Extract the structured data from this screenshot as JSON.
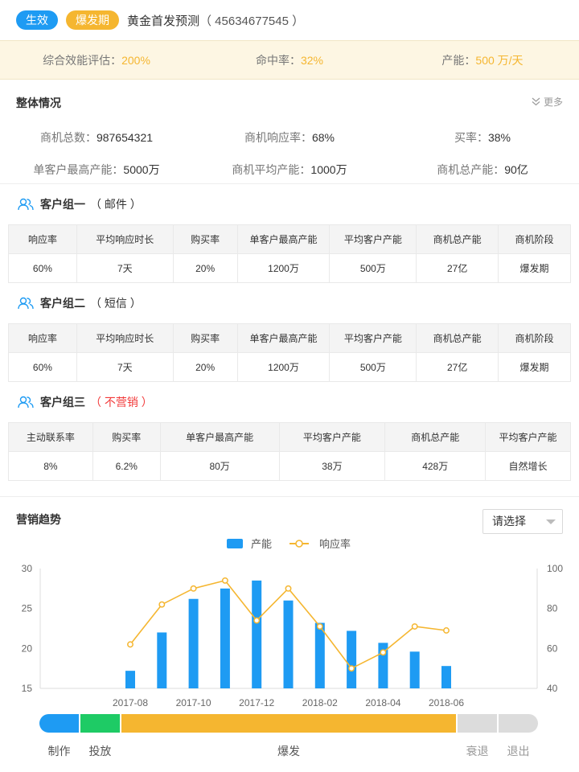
{
  "header": {
    "tag_active": "生效",
    "tag_phase": "爆发期",
    "title": "黄金首发预测",
    "id_text": "（ 45634677545 ）"
  },
  "summary": [
    {
      "label": "综合效能评估：",
      "value": "200%"
    },
    {
      "label": "命中率：",
      "value": "32%"
    },
    {
      "label": "产能：",
      "value": "500 万/天"
    }
  ],
  "overall": {
    "title": "整体情况",
    "more": "更多",
    "stats": [
      {
        "label": "商机总数：",
        "value": "987654321"
      },
      {
        "label": "商机响应率：",
        "value": "68%"
      },
      {
        "label": "买率：",
        "value": "38%"
      },
      {
        "label": "单客户最高产能：",
        "value": "5000万"
      },
      {
        "label": "商机平均产能：",
        "value": "1000万"
      },
      {
        "label": "商机总产能：",
        "value": "90亿"
      }
    ]
  },
  "groups": [
    {
      "title": "客户组一",
      "channel": "（ 邮件 ）",
      "headers": [
        "响应率",
        "平均响应时长",
        "购买率",
        "单客户最高产能",
        "平均客户产能",
        "商机总产能",
        "商机阶段"
      ],
      "row": [
        "60%",
        "7天",
        "20%",
        "1200万",
        "500万",
        "27亿",
        "爆发期"
      ]
    },
    {
      "title": "客户组二",
      "channel": "（ 短信 ）",
      "headers": [
        "响应率",
        "平均响应时长",
        "购买率",
        "单客户最高产能",
        "平均客户产能",
        "商机总产能",
        "商机阶段"
      ],
      "row": [
        "60%",
        "7天",
        "20%",
        "1200万",
        "500万",
        "27亿",
        "爆发期"
      ]
    },
    {
      "title": "客户组三",
      "channel": "（ 不营销 ）",
      "headers": [
        "主动联系率",
        "购买率",
        "单客户最高产能",
        "平均客户产能",
        "商机总产能",
        "平均客户产能"
      ],
      "row": [
        "8%",
        "6.2%",
        "80万",
        "38万",
        "428万",
        "自然增长"
      ]
    }
  ],
  "trend": {
    "title": "营销趋势",
    "select_placeholder": "请选择",
    "phases": [
      {
        "label": "制作",
        "color": "#1e9bf3",
        "weight": 1,
        "label_color": "#555"
      },
      {
        "label": "投放",
        "color": "#1ecb65",
        "weight": 1,
        "label_color": "#555"
      },
      {
        "label": "爆发",
        "color": "#f5b630",
        "weight": 8.5,
        "label_color": "#555"
      },
      {
        "label": "衰退",
        "color": "#dcdcdc",
        "weight": 1,
        "label_color": "#999"
      },
      {
        "label": "退出",
        "color": "#dcdcdc",
        "weight": 1,
        "label_color": "#999"
      }
    ]
  },
  "chart_data": {
    "type": "bar",
    "x": [
      "2017-08",
      "2017-09",
      "2017-10",
      "2017-11",
      "2017-12",
      "2018-01",
      "2018-02",
      "2018-03",
      "2018-04",
      "2018-05",
      "2018-06"
    ],
    "xtick_labels": [
      "2017-08",
      "2017-10",
      "2017-12",
      "2018-02",
      "2018-04",
      "2018-06"
    ],
    "series": [
      {
        "name": "产能",
        "type": "bar",
        "axis": "left",
        "color": "#1e9bf3",
        "values": [
          17.2,
          22.0,
          26.2,
          27.5,
          28.5,
          26.0,
          23.2,
          22.2,
          20.7,
          19.6,
          17.8
        ]
      },
      {
        "name": "响应率",
        "type": "line",
        "axis": "right",
        "color": "#f5b630",
        "values": [
          62,
          82,
          90,
          94,
          74,
          90,
          71,
          50,
          58,
          71,
          69
        ]
      }
    ],
    "ylim_left": [
      15,
      30
    ],
    "yticks_left": [
      15,
      20,
      25,
      30
    ],
    "ylim_right": [
      40,
      100
    ],
    "yticks_right": [
      40,
      60,
      80,
      100
    ],
    "legend": "top-center",
    "grid": false
  }
}
